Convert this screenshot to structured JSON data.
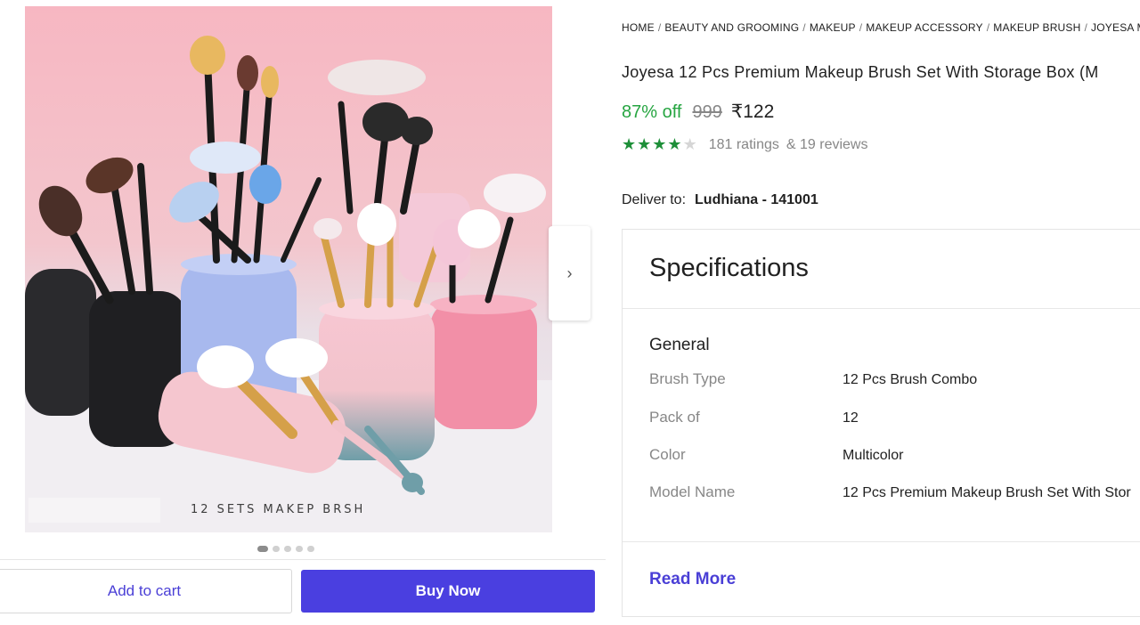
{
  "gallery": {
    "caption": "12 SETS MAKEP BRSH",
    "dots": [
      true,
      false,
      false,
      false,
      false
    ]
  },
  "actions": {
    "add_to_cart": "Add to cart",
    "buy_now": "Buy Now"
  },
  "breadcrumb": [
    "HOME",
    "BEAUTY AND GROOMING",
    "MAKEUP",
    "MAKEUP ACCESSORY",
    "MAKEUP BRUSH",
    "JOYESA MA"
  ],
  "product": {
    "title": "Joyesa 12 Pcs Premium Makeup Brush Set With Storage Box (M",
    "discount": "87% off",
    "mrp": "999",
    "price": "₹122",
    "rating": 4,
    "rating_max": 5,
    "ratings_text": "181 ratings",
    "reviews_text": "& 19 reviews"
  },
  "delivery": {
    "label": "Deliver to:",
    "location": "Ludhiana - 141001"
  },
  "specifications": {
    "title": "Specifications",
    "section": "General",
    "rows": [
      {
        "key": "Brush Type",
        "value": "12 Pcs Brush Combo"
      },
      {
        "key": "Pack of",
        "value": "12"
      },
      {
        "key": "Color",
        "value": "Multicolor"
      },
      {
        "key": "Model Name",
        "value": "12 Pcs Premium Makeup Brush Set With Stor"
      }
    ],
    "read_more": "Read More"
  },
  "colors": {
    "accent": "#4a3fe0",
    "discount": "#26a541",
    "star": "#1d8f38"
  }
}
